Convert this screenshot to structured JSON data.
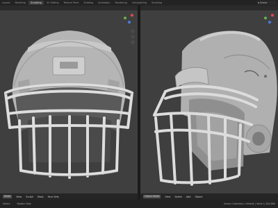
{
  "topbar": {
    "tabs": [
      "Layout",
      "Modeling",
      "Sculpting",
      "UV Editing",
      "Texture Paint",
      "Shading",
      "Animation",
      "Rendering",
      "Compositing",
      "Scripting"
    ],
    "active_index": 2,
    "scene_label": "Scene"
  },
  "left_viewport": {
    "mode": "Sculpt Mode",
    "footer": [
      "Mode",
      "View",
      "Sculpt",
      "Mask",
      "Face Sets"
    ],
    "axis_colors": {
      "x": "#e24a4a",
      "y": "#6ab04c",
      "z": "#4a7de2"
    }
  },
  "right_viewport": {
    "mode": "Object Mode",
    "footer": [
      "Object Mode",
      "View",
      "Select",
      "Add",
      "Object"
    ],
    "axis_colors": {
      "x": "#e24a4a",
      "y": "#6ab04c",
      "z": "#4a7de2"
    }
  },
  "statusbar": {
    "left": "Select",
    "middle": "Rotate View",
    "right": "Scene Collection | Helmet | Verts 1,204,880"
  },
  "colors": {
    "viewport_bg": "#3f3f3f",
    "helmet": "#b9b9b9",
    "facemask": "#d8d8d8",
    "accent": "#e2a83a"
  }
}
